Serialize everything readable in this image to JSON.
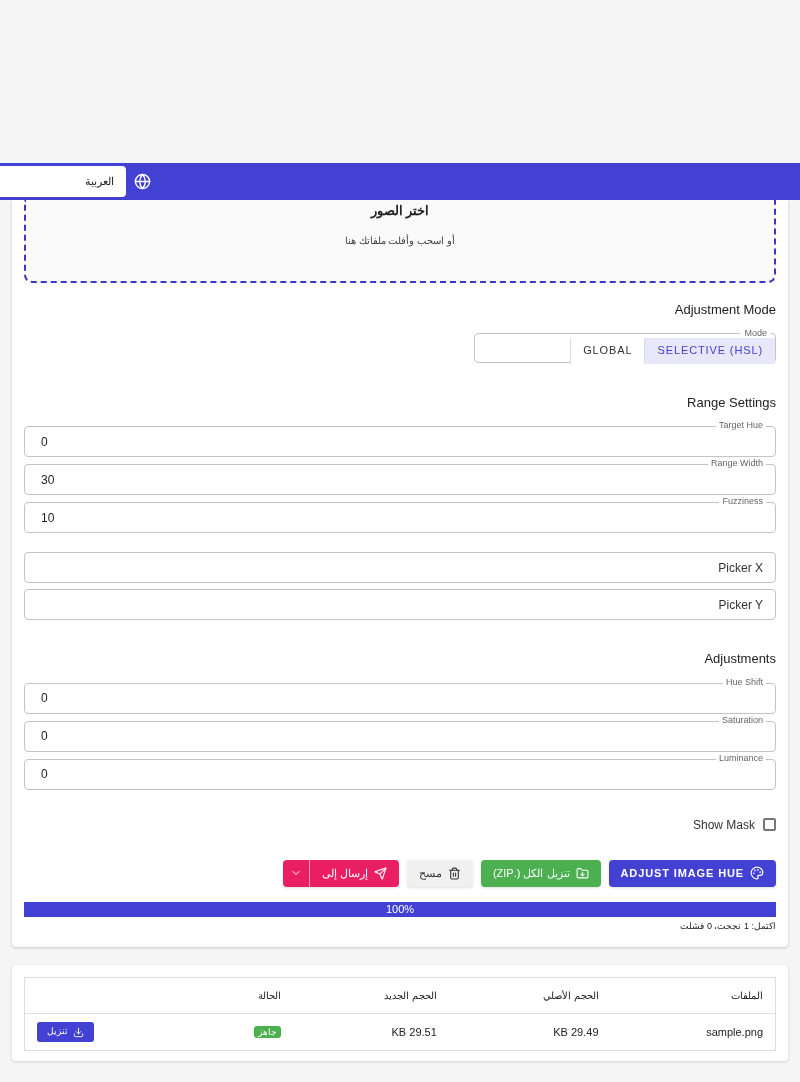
{
  "app_bar": {
    "language": "العربية"
  },
  "dropzone": {
    "title": "اختر الصور",
    "hint": "أو اسحب وأفلت ملفاتك هنا"
  },
  "adjustment_mode": {
    "heading": "Adjustment Mode",
    "label": "Mode",
    "options": [
      {
        "label": "SELECTIVE (HSL)",
        "selected": true
      },
      {
        "label": "GLOBAL",
        "selected": false
      }
    ]
  },
  "range_settings": {
    "heading": "Range Settings",
    "fields": [
      {
        "kind": "labeled",
        "label": "Target Hue",
        "value": "0"
      },
      {
        "kind": "labeled",
        "label": "Range Width",
        "value": "30"
      },
      {
        "kind": "labeled",
        "label": "Fuzziness",
        "value": "10"
      }
    ]
  },
  "picker_fields": [
    {
      "kind": "plain",
      "placeholder": "Picker X"
    },
    {
      "kind": "plain",
      "placeholder": "Picker Y"
    }
  ],
  "adjustments": {
    "heading": "Adjustments",
    "fields": [
      {
        "kind": "labeled",
        "label": "Hue Shift",
        "value": "0"
      },
      {
        "kind": "labeled",
        "label": "Saturation",
        "value": "0"
      },
      {
        "kind": "labeled",
        "label": "Luminance",
        "value": "0"
      }
    ]
  },
  "show_mask": {
    "label": "Show Mask",
    "checked": false
  },
  "buttons": {
    "adjust": "ADJUST IMAGE HUE",
    "download_all": "تنزيل الكل (.ZIP)",
    "clear": "مسح",
    "send_to": "إرسال إلى"
  },
  "progress": {
    "level": 1,
    "reading": "100%"
  },
  "status": "اكتمل: 1 نجحت، 0 فشلت",
  "table": {
    "columns": [
      "الملفات",
      "الحجم الأصلي",
      "الحجم الجديد",
      "الحالة"
    ],
    "rows": [
      {
        "file": "sample.png",
        "original_size": "29.49 KB",
        "new_size": "29.51 KB",
        "status": "جاهز",
        "action": "تنزيل"
      }
    ]
  }
}
